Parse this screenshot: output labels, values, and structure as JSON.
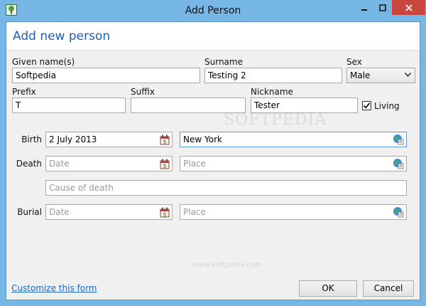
{
  "window": {
    "title": "Add Person"
  },
  "header": {
    "title": "Add new person"
  },
  "fields": {
    "given_name": {
      "label": "Given name(s)",
      "value": "Softpedia"
    },
    "surname": {
      "label": "Surname",
      "value": "Testing 2"
    },
    "sex": {
      "label": "Sex",
      "value": "Male"
    },
    "prefix": {
      "label": "Prefix",
      "value": "T"
    },
    "suffix": {
      "label": "Suffix",
      "value": ""
    },
    "nickname": {
      "label": "Nickname",
      "value": "Tester"
    },
    "living": {
      "label": "Living",
      "checked": true
    }
  },
  "events": {
    "birth": {
      "label": "Birth",
      "date": "2 July 2013",
      "place": "New York"
    },
    "death": {
      "label": "Death",
      "date_placeholder": "Date",
      "place_placeholder": "Place",
      "cause_placeholder": "Cause of death"
    },
    "burial": {
      "label": "Burial",
      "date_placeholder": "Date",
      "place_placeholder": "Place"
    }
  },
  "footer": {
    "customize_link": "Customize this form",
    "ok": "OK",
    "cancel": "Cancel"
  },
  "watermarks": {
    "main": "SOFTPEDIA",
    "url": "www.softpedia.com"
  },
  "icons": {
    "app": "tree-icon",
    "calendar": "calendar-icon",
    "place": "globe-icon"
  },
  "colors": {
    "titlebar": "#77b7e6",
    "header_text": "#1f5fb2",
    "close_button": "#c7473f",
    "link": "#1a66c8"
  }
}
